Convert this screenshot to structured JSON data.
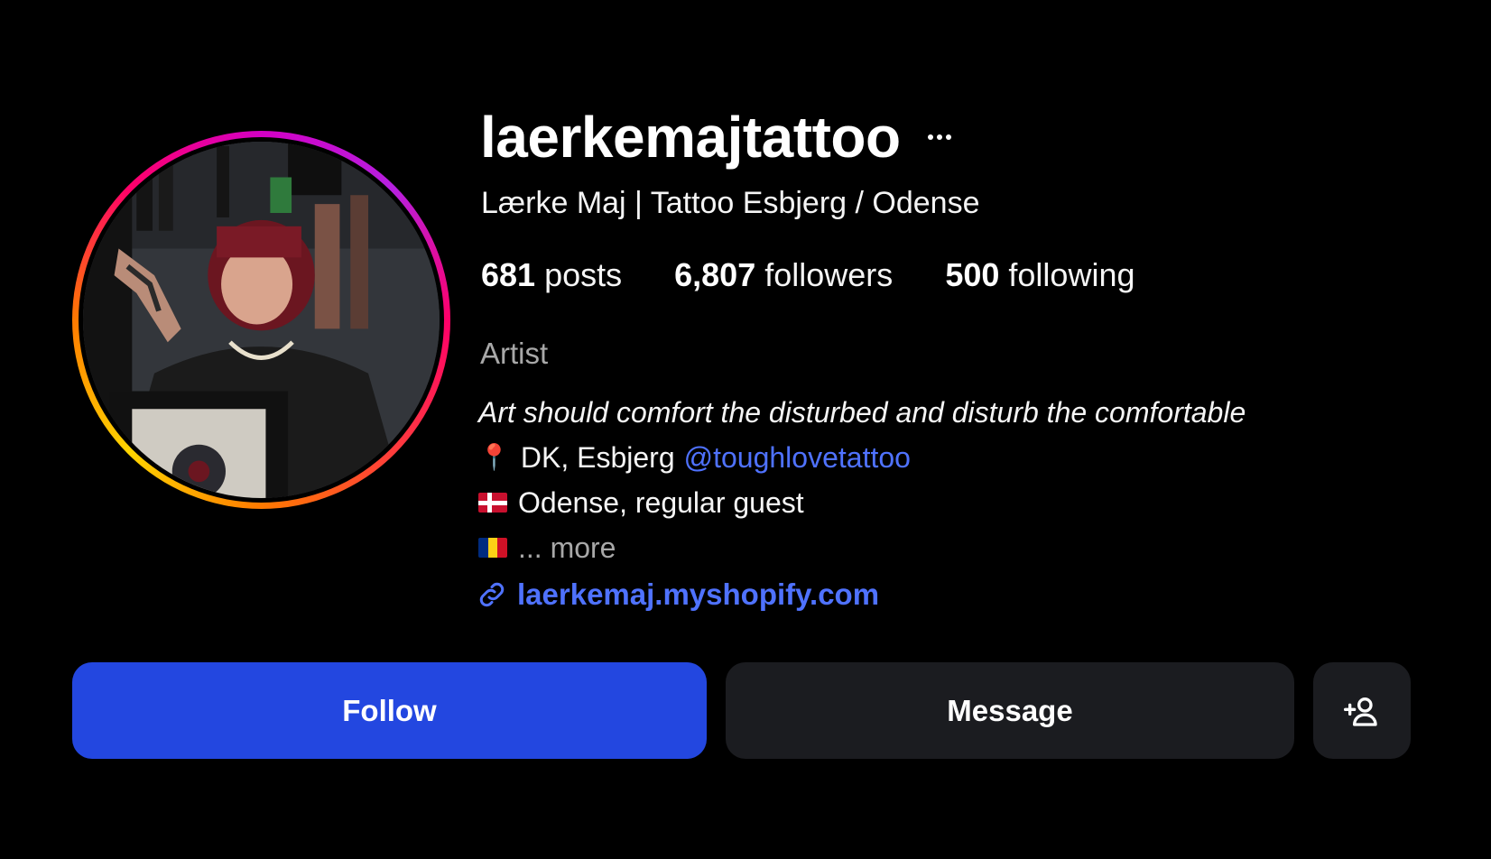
{
  "profile": {
    "username": "laerkemajtattoo",
    "full_name": "Lærke Maj | Tattoo Esbjerg / Odense",
    "avatar_icon": "profile-photo-tattoo-artist",
    "ring_colors": [
      "#d300c5",
      "#ff0069",
      "#ff7a00",
      "#ffd600"
    ]
  },
  "stats": {
    "posts_count": "681",
    "posts_label": "posts",
    "followers_count": "6,807",
    "followers_label": "followers",
    "following_count": "500",
    "following_label": "following"
  },
  "category": "Artist",
  "bio": {
    "quote": "Art should comfort the disturbed and disturb the comfortable",
    "line1_icon": "round-pushpin-icon",
    "line1_text": "DK, Esbjerg",
    "line1_mention": "@toughlovetattoo",
    "line2_icon": "denmark-flag-icon",
    "line2_text": "Odense, regular guest",
    "line3_icon": "romania-flag-icon",
    "line3_more": "... more",
    "pin_glyph": "📍"
  },
  "link": {
    "icon": "link-icon",
    "text": "laerkemaj.myshopify.com"
  },
  "actions": {
    "follow_label": "Follow",
    "message_label": "Message",
    "suggest_icon": "add-person-icon"
  },
  "colors": {
    "background": "#000000",
    "accent_blue": "#2347e0",
    "link_blue": "#4f72ff",
    "secondary_button": "#1b1c20",
    "muted_text": "#a8a8a8"
  }
}
